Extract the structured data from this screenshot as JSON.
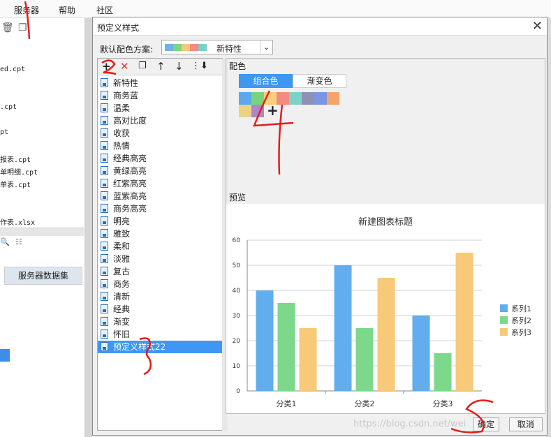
{
  "menu": [
    "服务器",
    "帮助",
    "社区"
  ],
  "background": {
    "files": [
      "ed.cpt",
      ".cpt",
      "pt",
      "报表.cpt",
      "单明细.cpt",
      "单表.cpt",
      "作表.xlsx"
    ],
    "tab_label": "服务器数据集"
  },
  "dialog": {
    "title": "预定义样式",
    "scheme_label": "默认配色方案:",
    "scheme_value": "新特性",
    "scheme_swatches": [
      "#6fb1e8",
      "#7fd38a",
      "#f7c97a",
      "#f28b82",
      "#79d0c8"
    ],
    "list_items": [
      "新特性",
      "商务蓝",
      "温柔",
      "高对比度",
      "收获",
      "热情",
      "经典高亮",
      "黄绿高亮",
      "红紫高亮",
      "蓝紫高亮",
      "商务高亮",
      "明亮",
      "雅致",
      "柔和",
      "淡雅",
      "复古",
      "商务",
      "清新",
      "经典",
      "渐变",
      "怀旧",
      "预定义样式22"
    ],
    "selected_item": "预定义样式22",
    "color_section_label": "配色",
    "tab_combo": "组合色",
    "tab_gradient": "渐变色",
    "palette_colors": [
      "#5aa9ec",
      "#76d47c",
      "#f8cf7d",
      "#f28b82",
      "#7ed1c9",
      "#8d91b3",
      "#7b95e2",
      "#f5a36c",
      "#ead383",
      "#a989c8"
    ],
    "preview_label": "预览",
    "ok_button": "确定",
    "cancel_button": "取消"
  },
  "chart_data": {
    "type": "bar",
    "title": "新建图表标题",
    "categories": [
      "分类1",
      "分类2",
      "分类3"
    ],
    "series": [
      {
        "name": "系列1",
        "values": [
          40,
          50,
          30
        ],
        "color": "#62aded"
      },
      {
        "name": "系列2",
        "values": [
          35,
          25,
          15
        ],
        "color": "#7cd88a"
      },
      {
        "name": "系列3",
        "values": [
          25,
          45,
          55
        ],
        "color": "#f7c978"
      }
    ],
    "ylim": [
      0,
      60
    ],
    "yticks": [
      0,
      10,
      20,
      30,
      40,
      50,
      60
    ],
    "grid": true,
    "legend": "right"
  },
  "annotations": [
    "1",
    "2",
    "3",
    "4",
    "5"
  ],
  "watermark": "https://blog.csdn.net/wei"
}
